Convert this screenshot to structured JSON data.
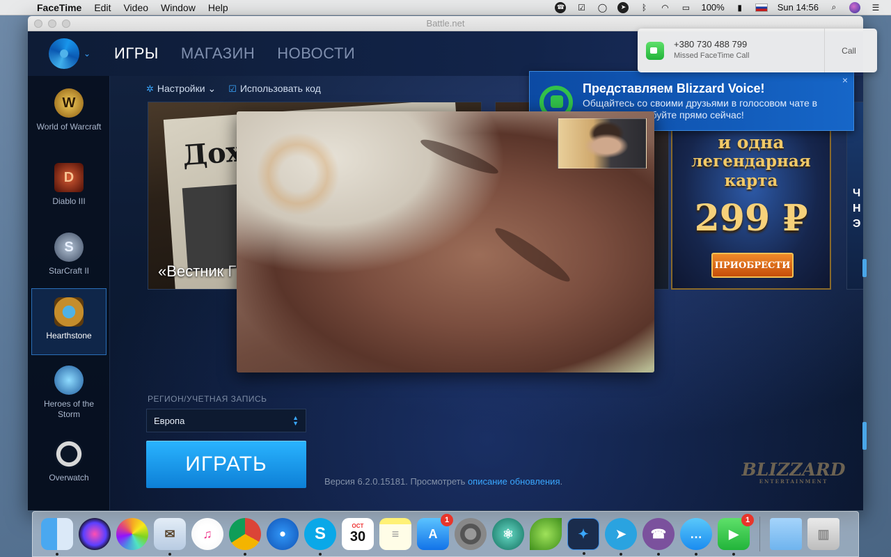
{
  "menubar": {
    "apple": "",
    "app_name": "FaceTime",
    "items": [
      "Edit",
      "Video",
      "Window",
      "Help"
    ],
    "battery": "100%",
    "clock": "Sun 14:56",
    "status_icons": [
      "viber-icon",
      "check-icon",
      "chat-icon",
      "telegram-icon",
      "bluetooth-icon",
      "wifi-icon",
      "airplay-icon",
      "battery-icon",
      "flag-ru-icon",
      "search-icon",
      "siri-icon",
      "list-icon"
    ]
  },
  "window": {
    "title": "Battle.net"
  },
  "nav": {
    "games": "ИГРЫ",
    "shop": "МАГАЗИН",
    "news": "НОВОСТИ"
  },
  "sidebar": {
    "items": [
      {
        "label": "World of Warcraft",
        "icon": "wow-icon",
        "glyph": "W"
      },
      {
        "label": "Diablo III",
        "icon": "diablo-icon",
        "glyph": "D"
      },
      {
        "label": "StarCraft II",
        "icon": "starcraft-icon",
        "glyph": "S"
      },
      {
        "label": "Hearthstone",
        "icon": "hearthstone-icon",
        "glyph": ""
      },
      {
        "label": "Heroes of the Storm",
        "icon": "heroes-icon",
        "glyph": ""
      },
      {
        "label": "Overwatch",
        "icon": "overwatch-icon",
        "glyph": ""
      }
    ]
  },
  "toolbar": {
    "settings": "Настройки",
    "redeem": "Использовать код"
  },
  "banners": {
    "news_headline": "Дох",
    "news_caption": "«Вестник Г",
    "promo_line1": "и одна",
    "promo_line2": "легендарная карта",
    "promo_price": "299 ₽",
    "promo_button": "ПРИОБРЕСТИ",
    "edge_letters": "Ч Н Э"
  },
  "voice_popup": {
    "title": "Представляем Blizzard Voice!",
    "text": "Общайтесь со своими друзьями в голосовом чате в Blizzard. Попробуйте прямо сейчас!",
    "close": "×"
  },
  "region": {
    "label": "РЕГИОН/УЧЕТНАЯ ЗАПИСЬ",
    "value": "Европа"
  },
  "play_button": "ИГРАТЬ",
  "version": {
    "prefix": "Версия 6.2.0.15181. Просмотреть ",
    "link": "описание обновления",
    "suffix": "."
  },
  "blizzard_logo": {
    "text": "BLIZZARD",
    "sub": "ENTERTAINMENT"
  },
  "notification": {
    "number": "+380 730 488 799",
    "subtitle": "Missed FaceTime Call",
    "action": "Call"
  },
  "dock": {
    "calendar_month": "OCT",
    "calendar_day": "30",
    "appstore_badge": "1",
    "facetime_badge": "1"
  }
}
